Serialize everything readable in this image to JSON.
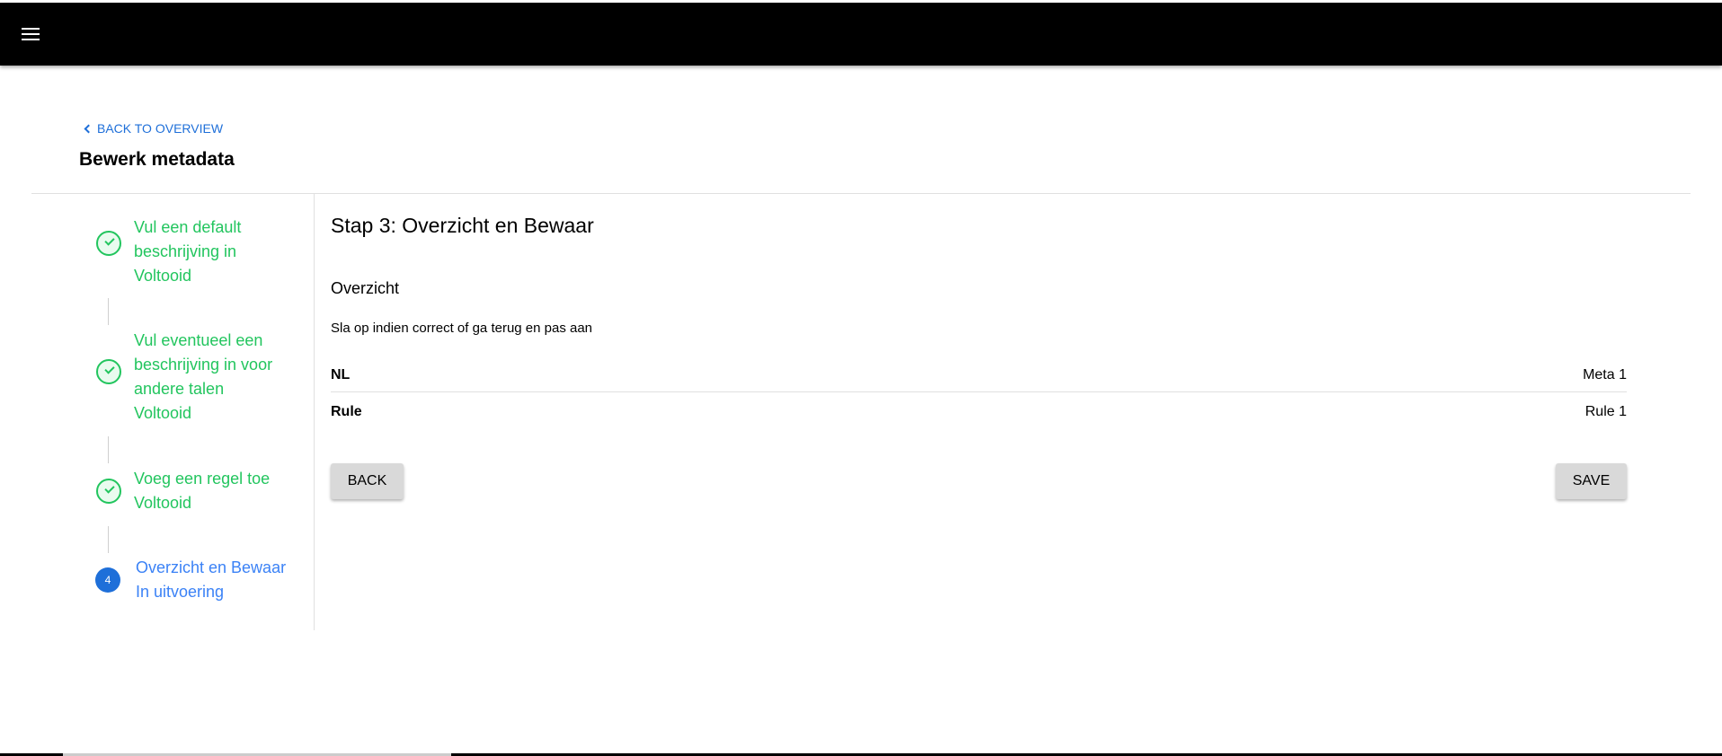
{
  "header": {
    "menu_icon": "hamburger-menu-icon"
  },
  "page": {
    "back_label": "BACK TO OVERVIEW",
    "title": "Bewerk metadata"
  },
  "stepper": {
    "steps": [
      {
        "title_lines": [
          "Vul een default",
          "beschrijving in"
        ],
        "status": "Voltooid",
        "state": "done"
      },
      {
        "title_lines": [
          "Vul eventueel een",
          "beschrijving in voor",
          "andere talen"
        ],
        "status": "Voltooid",
        "state": "done"
      },
      {
        "title_lines": [
          "Voeg een regel toe"
        ],
        "status": "Voltooid",
        "state": "done"
      },
      {
        "number": "4",
        "title_lines": [
          "Overzicht en Bewaar"
        ],
        "status": "In uitvoering",
        "state": "active"
      }
    ]
  },
  "content": {
    "step_title": "Stap 3: Overzicht en Bewaar",
    "section_title": "Overzicht",
    "section_desc": "Sla op indien correct of ga terug en pas aan",
    "rows": [
      {
        "key": "NL",
        "value": "Meta 1"
      },
      {
        "key": "Rule",
        "value": "Rule 1"
      }
    ],
    "back_button": "BACK",
    "save_button": "SAVE"
  },
  "colors": {
    "accent": "#1e6fd9",
    "done": "#22c55e",
    "active_text": "#3b82f6",
    "button_bg": "#d9d9d9",
    "topbar_bg": "#000000"
  }
}
